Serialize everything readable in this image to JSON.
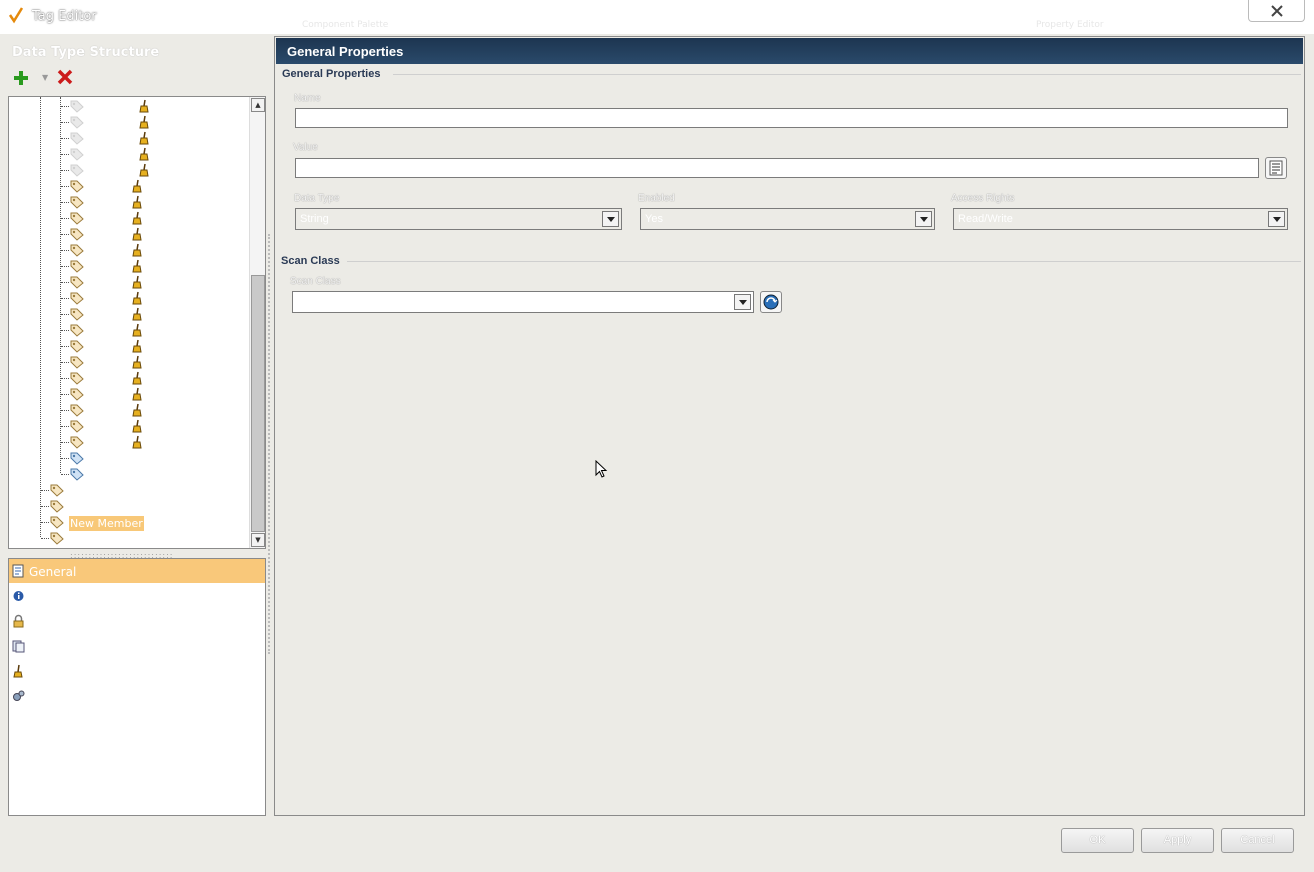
{
  "window": {
    "title": "Tag Editor"
  },
  "background_tabs": [
    "Component Palette",
    "Property Editor"
  ],
  "left_panel": {
    "header": "Data Type Structure",
    "tree": {
      "selected_item_label": "New Member"
    },
    "categories": [
      {
        "label": "General",
        "icon": "general-page-icon",
        "selected": true
      },
      {
        "label": "",
        "icon": "info-icon"
      },
      {
        "label": "",
        "icon": "lock-icon"
      },
      {
        "label": "",
        "icon": "document-icon"
      },
      {
        "label": "",
        "icon": "broom-icon"
      },
      {
        "label": "",
        "icon": "gears-icon"
      }
    ]
  },
  "right_panel": {
    "header": "General Properties",
    "general_section": {
      "title": "General Properties",
      "name_label": "Name",
      "name_value": "",
      "value_label": "Value",
      "value_value": "",
      "data_type_label": "Data Type",
      "data_type_value": "String",
      "enabled_label": "Enabled",
      "enabled_value": "Yes",
      "access_rights_label": "Access Rights",
      "access_rights_value": "Read/Write"
    },
    "scan_section": {
      "title": "Scan Class",
      "scan_class_label": "Scan Class",
      "scan_class_value": ""
    }
  },
  "buttons": {
    "ok": "OK",
    "apply": "Apply",
    "cancel": "Cancel"
  },
  "colors": {
    "header_bg": "#1d3550",
    "selection": "#f9c87a",
    "window_bg": "#ecebe6"
  }
}
